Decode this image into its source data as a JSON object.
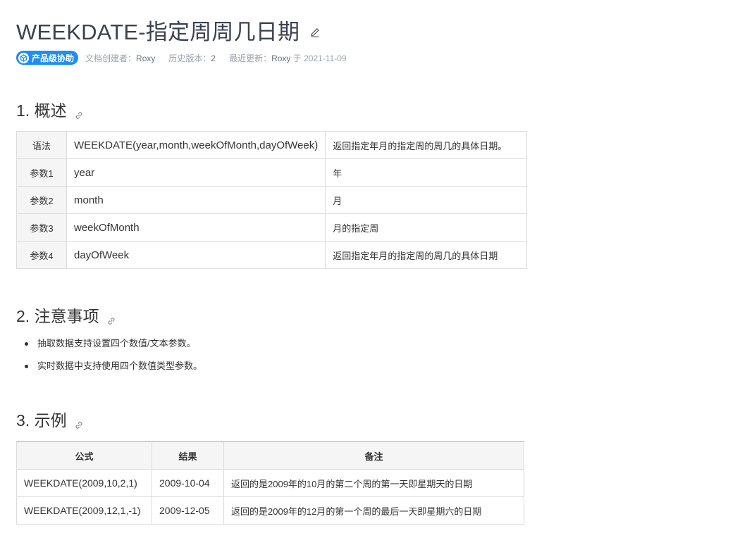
{
  "header": {
    "title": "WEEKDATE-指定周周几日期",
    "edit_icon": "pencil-icon"
  },
  "meta": {
    "badge": "产品级协助",
    "creator_label": "文档创建者：",
    "creator": "Roxy",
    "version_label": "历史版本：",
    "version": "2",
    "updated_label": "最近更新：",
    "updated_by": "Roxy",
    "updated_at": "于 2021-11-09"
  },
  "sections": {
    "overview": "1. 概述",
    "notes": "2. 注意事项",
    "example": "3. 示例"
  },
  "overview_table": [
    {
      "key": "语法",
      "value": "WEEKDATE(year,month,weekOfMonth,dayOfWeek)",
      "desc": "返回指定年月的指定周的周几的具体日期。"
    },
    {
      "key": "参数1",
      "value": "year",
      "desc": "年"
    },
    {
      "key": "参数2",
      "value": "month",
      "desc": "月"
    },
    {
      "key": "参数3",
      "value": "weekOfMonth",
      "desc": "月的指定周"
    },
    {
      "key": "参数4",
      "value": "dayOfWeek",
      "desc": "返回指定年月的指定周的周几的具体日期"
    }
  ],
  "notes_list": [
    "抽取数据支持设置四个数值/文本参数。",
    "实时数据中支持使用四个数值类型参数。"
  ],
  "example_table": {
    "headers": [
      "公式",
      "结果",
      "备注"
    ],
    "rows": [
      [
        "WEEKDATE(2009,10,2,1)",
        "2009-10-04",
        "返回的是2009年的10月的第二个周的第一天即星期天的日期"
      ],
      [
        "WEEKDATE(2009,12,1,-1)",
        "2009-12-05",
        "返回的是2009年的12月的第一个周的最后一天即星期六的日期"
      ]
    ]
  },
  "colors": {
    "badge": "#1e8ef0",
    "title": "#3b4151",
    "header_bg": "#f5f5f5",
    "border": "#dcdcdc"
  }
}
